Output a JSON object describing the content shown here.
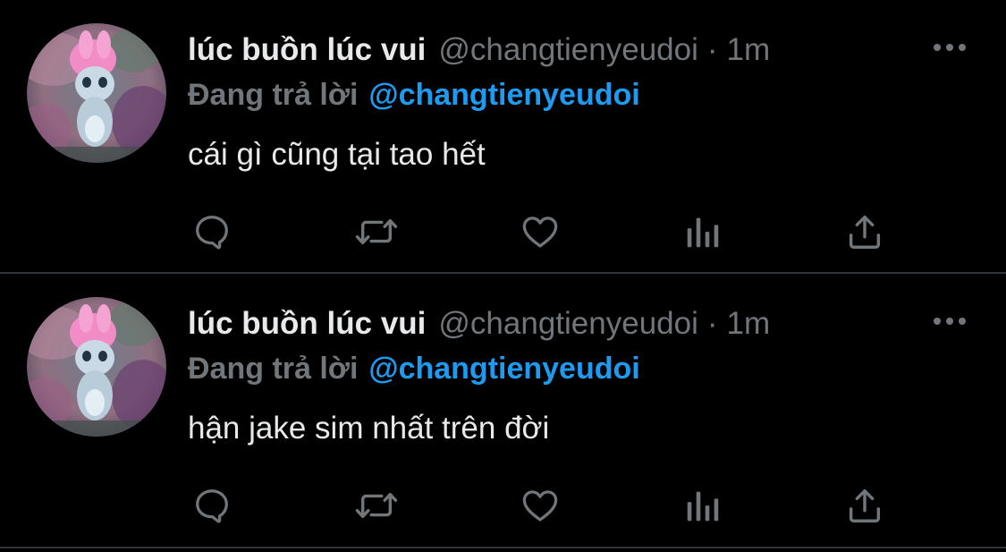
{
  "colors": {
    "background": "#000000",
    "divider": "#2f3336",
    "name_text": "#e7e9ea",
    "muted_text": "#71767b",
    "accent_blue": "#1d9bf0"
  },
  "tweets": [
    {
      "avatar_icon": "pink-bunny-avatar",
      "display_name": "lúc buồn lúc vui",
      "handle": "@changtienyeudoi",
      "separator": "·",
      "time": "1m",
      "reply_label": "Đang trả lời",
      "reply_to": "@changtienyeudoi",
      "text": "cái gì cũng tại tao hết",
      "more_icon": "more-dots-icon",
      "actions": [
        "reply-icon",
        "retweet-icon",
        "like-icon",
        "views-icon",
        "share-icon"
      ]
    },
    {
      "avatar_icon": "pink-bunny-avatar",
      "display_name": "lúc buồn lúc vui",
      "handle": "@changtienyeudoi",
      "separator": "·",
      "time": "1m",
      "reply_label": "Đang trả lời",
      "reply_to": "@changtienyeudoi",
      "text": "hận jake sim nhất trên đời",
      "more_icon": "more-dots-icon",
      "actions": [
        "reply-icon",
        "retweet-icon",
        "like-icon",
        "views-icon",
        "share-icon"
      ]
    }
  ]
}
